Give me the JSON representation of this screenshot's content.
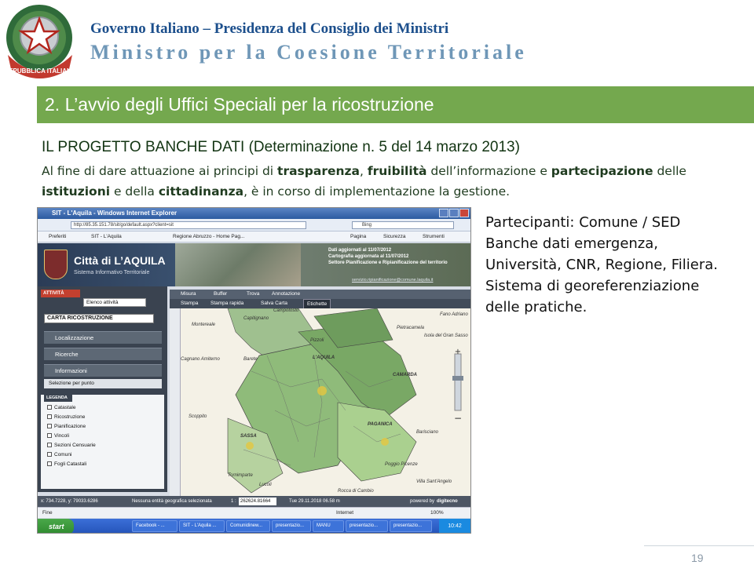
{
  "header": {
    "government": "Governo Italiano – Presidenza del Consiglio dei Ministri",
    "ministry": "Ministro per la Coesione Territoriale",
    "emblem_text": "REPUBBLICA ITALIANA"
  },
  "slide": {
    "title": "2. L’avvio degli Uffici Speciali per la ricostruzione",
    "section_title": "IL PROGETTO BANCHE DATI (Determinazione n. 5 del 14 marzo 2013)",
    "paragraph": {
      "p1": "Al fine di dare attuazione ai principi di ",
      "b1": "trasparenza",
      "p2": ", ",
      "b2": "fruibilità",
      "p3": " dell’informazione e ",
      "b3": "partecipazione",
      "p4": " delle ",
      "b4": "istituzioni",
      "p5": " e della ",
      "b5": "cittadinanza",
      "p6": ", è in corso di implementazione la gestione."
    },
    "side_text": {
      "line1": "Partecipanti: Comune / SED",
      "line2": "Banche dati emergenza,",
      "line3": "Università, CNR, Regione, Filiera.",
      "line4": "Sistema di georeferenziazione",
      "line5": "delle pratiche."
    },
    "page_number": "19"
  },
  "screenshot": {
    "window_title": "SIT - L'Aquila - Windows Internet Explorer",
    "address": "http://85.35.151.78/sit/go/default.aspx?client=sit",
    "search_engine": "Bing",
    "favorites": {
      "preferiti": "Preferiti",
      "tab1": "SIT - L'Aquila",
      "tab2": "Regione Abruzzo - Home Pag...",
      "pagina": "Pagina",
      "sicurezza": "Sicurezza",
      "strumenti": "Strumenti"
    },
    "banner": {
      "city": "Città di L’AQUILA",
      "subtitle": "Sistema Informativo Territoriale",
      "info1": "Dati aggiornati al 11/07/2012",
      "info2": "Cartografia aggiornata al 11/07/2012",
      "info3": "Settore Pianificazione e Ripianificazione del territorio",
      "email": "servizio.ripianificazione@comune.laquila.it"
    },
    "left_panel": {
      "attivita": "ATTIVITÀ",
      "elenco": "Elenco attività",
      "carta": "CARTA RICOSTRUZIONE",
      "menu": [
        "Localizzazione",
        "Ricerche",
        "Informazioni"
      ],
      "selezione": "Selezione per punto",
      "legenda": "LEGENDA",
      "layers": [
        "Catastale",
        "Ricostruzione",
        "Pianificazione",
        "Vincoli",
        "Sezioni Censuarie",
        "Comuni",
        "Fogli Catastali"
      ]
    },
    "map_toolbar": {
      "row1": [
        "Misura",
        "Buffer",
        "Trova",
        "Annotazione"
      ],
      "row2": [
        "Stampa",
        "Stampa rapida",
        "Salva Carta",
        "Etichette"
      ]
    },
    "map_labels": [
      "Campotosto",
      "Capitignano",
      "Montereale",
      "Pizzoli",
      "Cagnano Amiterno",
      "Barete",
      "Pietracamela",
      "Isola del Gran Sasso",
      "Scoppito",
      "Tornimparte",
      "Lucoli",
      "L'AQUILA",
      "CAMARDA",
      "PAGANICA",
      "SASSA",
      "Barisciano",
      "Poggio Picenze",
      "Rocca di Cambio",
      "Villa Sant'Angelo",
      "Fano Adriano"
    ],
    "status": {
      "coords": "x: 734.7228, y: 79033.6286",
      "nessuna": "Nessuna entità geografica selezionata",
      "scale": "1 :",
      "scale_value": "262624.81664",
      "time": "Tue 29.11.2018 06.58 m",
      "powered": "powered by",
      "brand": "digitecno"
    },
    "ie_status": {
      "done": "Fine",
      "zone": "Internet",
      "zoom": "100%"
    },
    "taskbar": {
      "start": "start",
      "tasks": [
        "Facebook - ...",
        "SIT - L'Aquila ...",
        "Comunidinew...",
        "presentazio...",
        "MANU",
        "presentazio...",
        "presentazio..."
      ],
      "clock": "10:42"
    }
  }
}
